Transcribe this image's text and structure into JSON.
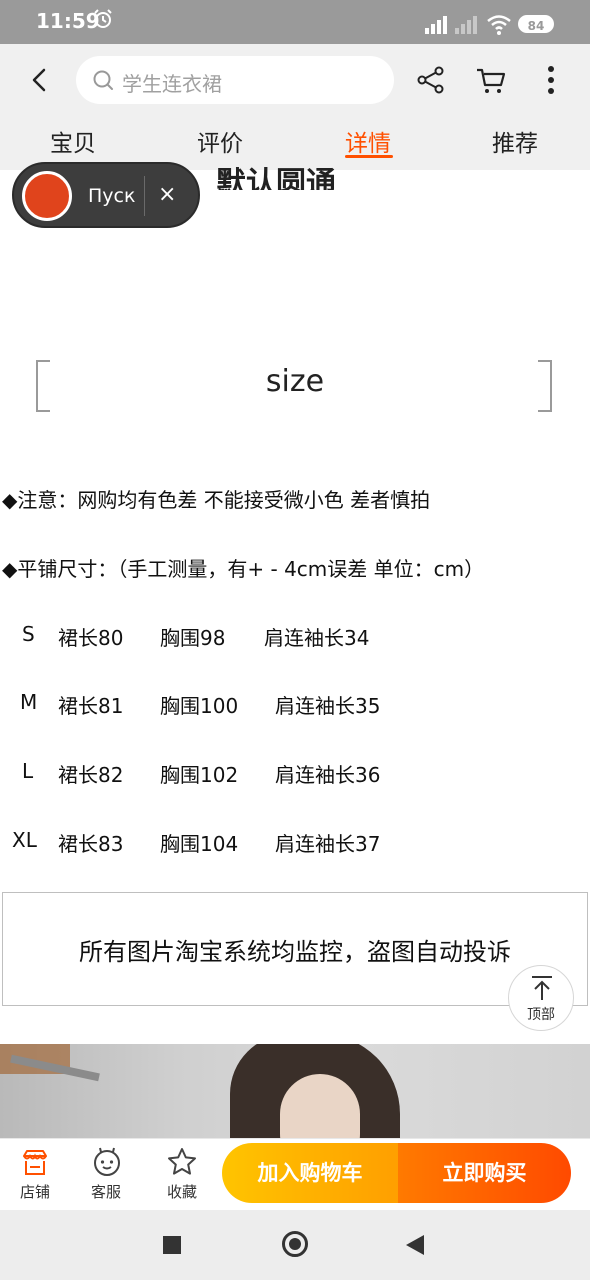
{
  "status": {
    "time": "11:59",
    "battery": "84"
  },
  "search": {
    "placeholder": "学生连衣裙"
  },
  "tabs": [
    {
      "label": "宝贝"
    },
    {
      "label": "评价"
    },
    {
      "label": "详情",
      "active": true
    },
    {
      "label": "推荐"
    }
  ],
  "capture_widget": {
    "label": "Пуск",
    "close": "×"
  },
  "partial_title": "默认圆通",
  "size_header": "size",
  "notes": {
    "note1": "◆注意：网购均有色差 不能接受微小色 差者慎拍",
    "note2": "◆平铺尺寸：（手工测量，有+ - 4cm误差 单位：cm）"
  },
  "size_table": [
    {
      "size": "S",
      "length": "裙长80",
      "bust": "胸围98",
      "sleeve": "肩连袖长34"
    },
    {
      "size": "M",
      "length": "裙长81",
      "bust": "胸围100",
      "sleeve": "肩连袖长35"
    },
    {
      "size": "L",
      "length": "裙长82",
      "bust": "胸围102",
      "sleeve": "肩连袖长36"
    },
    {
      "size": "XL",
      "length": "裙长83",
      "bust": "胸围104",
      "sleeve": "肩连袖长37"
    }
  ],
  "notice_box": "所有图片淘宝系统均监控，盗图自动投诉",
  "top_button": "顶部",
  "bottom_bar": {
    "store": "店铺",
    "service": "客服",
    "favorite": "收藏",
    "add_to_cart": "加入购物车",
    "buy_now": "立即购买"
  },
  "colors": {
    "accent": "#ff5000",
    "cart_gradient": [
      "#ffc400",
      "#ff9f00"
    ],
    "buy_gradient": [
      "#ff7a00",
      "#ff4a00"
    ]
  }
}
